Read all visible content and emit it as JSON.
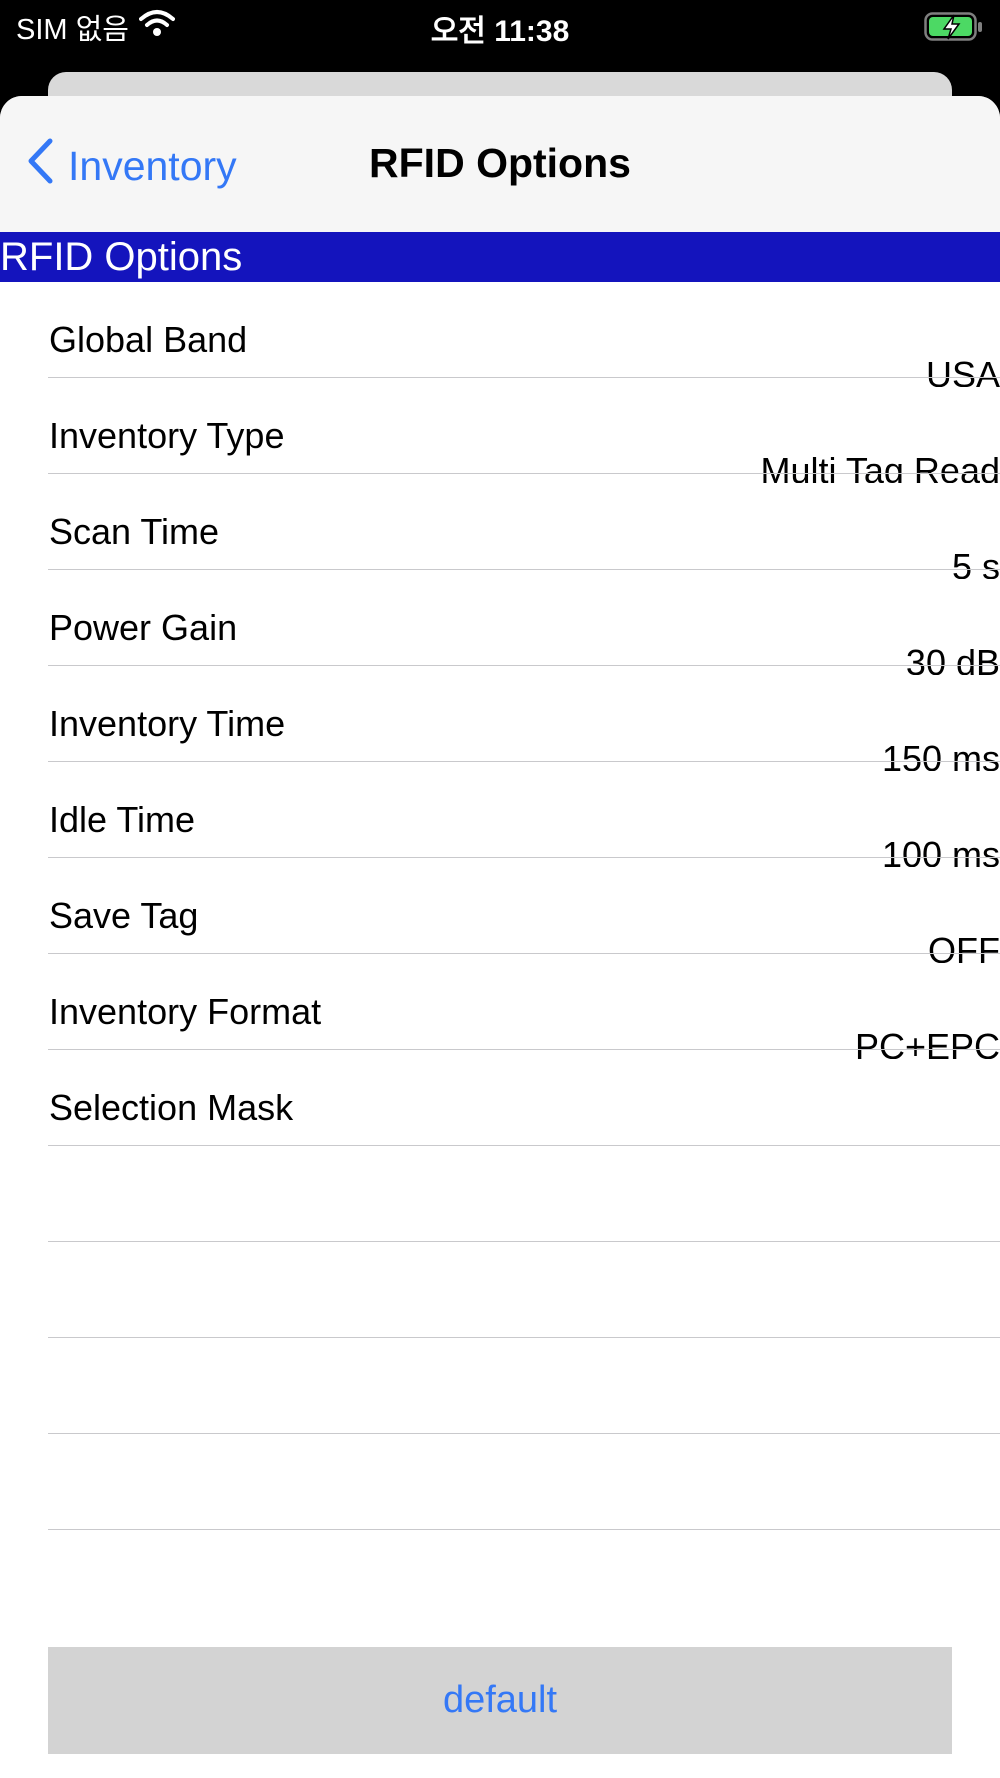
{
  "status_bar": {
    "carrier": "SIM 없음",
    "time": "오전 11:38",
    "battery_color": "#4cd964"
  },
  "nav": {
    "back_label": "Inventory",
    "title": "RFID Options"
  },
  "section": {
    "header": "RFID Options",
    "header_color": "#1414bd"
  },
  "rows": [
    {
      "label": "Global Band",
      "value": "USA"
    },
    {
      "label": "Inventory Type",
      "value": "Multi Tag Read"
    },
    {
      "label": "Scan Time",
      "value": "5 s"
    },
    {
      "label": "Power Gain",
      "value": "30 dB"
    },
    {
      "label": "Inventory Time",
      "value": "150 ms"
    },
    {
      "label": "Idle Time",
      "value": "100 ms"
    },
    {
      "label": "Save Tag",
      "value": "OFF"
    },
    {
      "label": "Inventory Format",
      "value": "PC+EPC"
    },
    {
      "label": "Selection Mask",
      "value": ""
    },
    {
      "label": "",
      "value": ""
    },
    {
      "label": "",
      "value": ""
    },
    {
      "label": "",
      "value": ""
    },
    {
      "label": "",
      "value": ""
    }
  ],
  "default_button": "default",
  "accent_color": "#3478f6"
}
